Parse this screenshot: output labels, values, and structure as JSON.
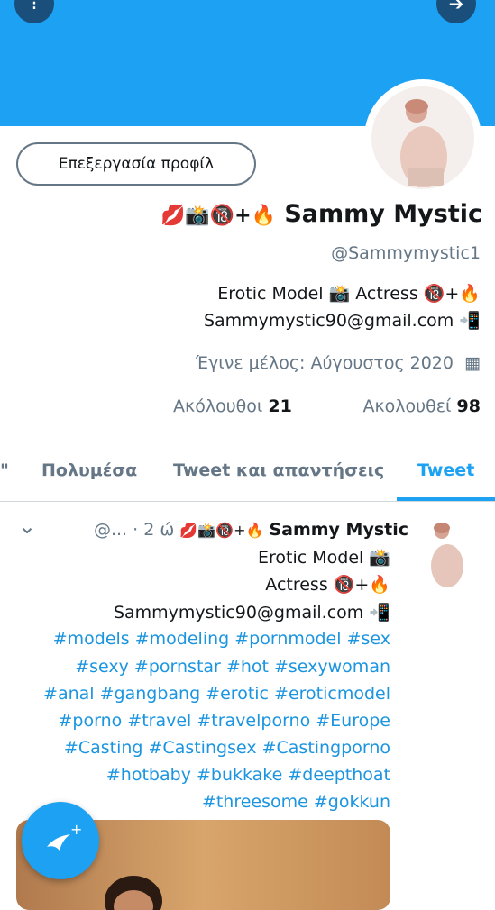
{
  "colors": {
    "banner": "#1da1f2",
    "accent": "#1da1f2",
    "link": "#1b95e0",
    "muted": "#657786"
  },
  "header": {
    "left_button_icon": "more-vertical-icon",
    "right_button_icon": "arrow-right-icon",
    "left_button_glyph": "⁝",
    "right_button_glyph": "➔"
  },
  "profile": {
    "edit_label": "Επεξεργασία προφίλ",
    "name": "Sammy Mystic",
    "name_emojis": "💋📸🔞+🔥",
    "handle": "@Sammymystic1",
    "bio_line1": "Erotic Model 📸 Actress 🔞+🔥",
    "bio_line2": "Sammymystic90@gmail.com 📲",
    "joined": "Έγινε μέλος: Αύγουστος 2020",
    "calendar_glyph": "▦",
    "following_count": "98",
    "following_label": "Ακολουθεί",
    "followers_count": "21",
    "followers_label": "Ακόλουθοι"
  },
  "tabs": [
    {
      "label": "Tweet"
    },
    {
      "label": "Tweet και απαντήσεις"
    },
    {
      "label": "Πολυμέσα"
    },
    {
      "label": "\""
    }
  ],
  "tweet": {
    "name": "Sammy Mystic",
    "name_emojis": "💋📸🔞+🔥",
    "meta": "@... · 2 ώ",
    "chevron": "⌄",
    "lines": [
      "Erotic Model 📸",
      "Actress 🔞+🔥",
      "Sammymystic90@gmail.com 📲"
    ],
    "hashtag_lines": [
      "#models #modeling #pornmodel #sex",
      "#sexy #pornstar #hot #sexywoman",
      "#anal #gangbang #erotic #eroticmodel",
      "#porno #travel #travelporno #Europe",
      "#Casting #Castingsex #Castingporno",
      "#hotbaby #bukkake #deepthoat",
      "#threesome #gokkun"
    ]
  },
  "fab": {
    "icon": "compose-tweet-icon",
    "glyph": "+"
  }
}
